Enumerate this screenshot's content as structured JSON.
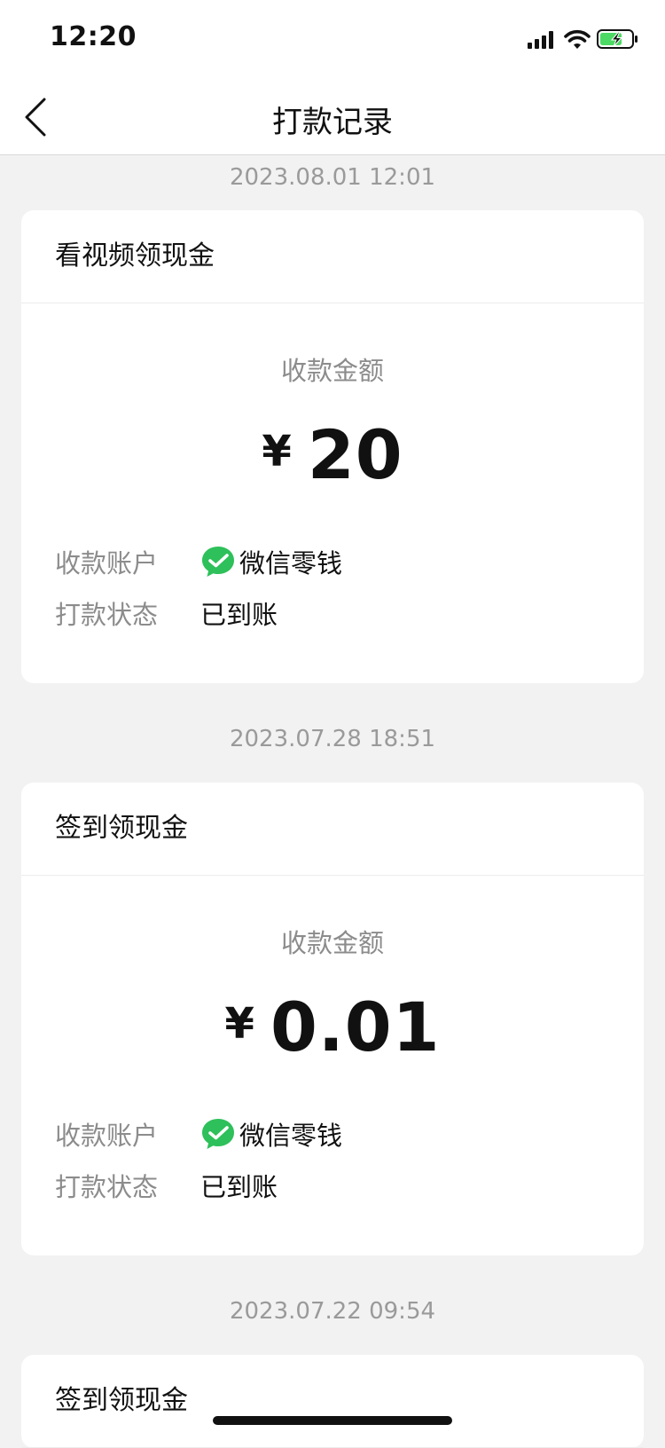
{
  "status_bar": {
    "time": "12:20"
  },
  "nav": {
    "title": "打款记录"
  },
  "records": [
    {
      "timestamp": "2023.08.01 12:01",
      "title": "看视频领现金",
      "amount_label": "收款金额",
      "currency": "¥",
      "amount": "20",
      "account_label": "收款账户",
      "account_value": "微信零钱",
      "status_label": "打款状态",
      "status_value": "已到账"
    },
    {
      "timestamp": "2023.07.28 18:51",
      "title": "签到领现金",
      "amount_label": "收款金额",
      "currency": "¥",
      "amount": "0.01",
      "account_label": "收款账户",
      "account_value": "微信零钱",
      "status_label": "打款状态",
      "status_value": "已到账"
    },
    {
      "timestamp": "2023.07.22 09:54",
      "title": "签到领现金"
    }
  ],
  "colors": {
    "wechat_green": "#2ec05a",
    "battery_green": "#4cd964"
  }
}
